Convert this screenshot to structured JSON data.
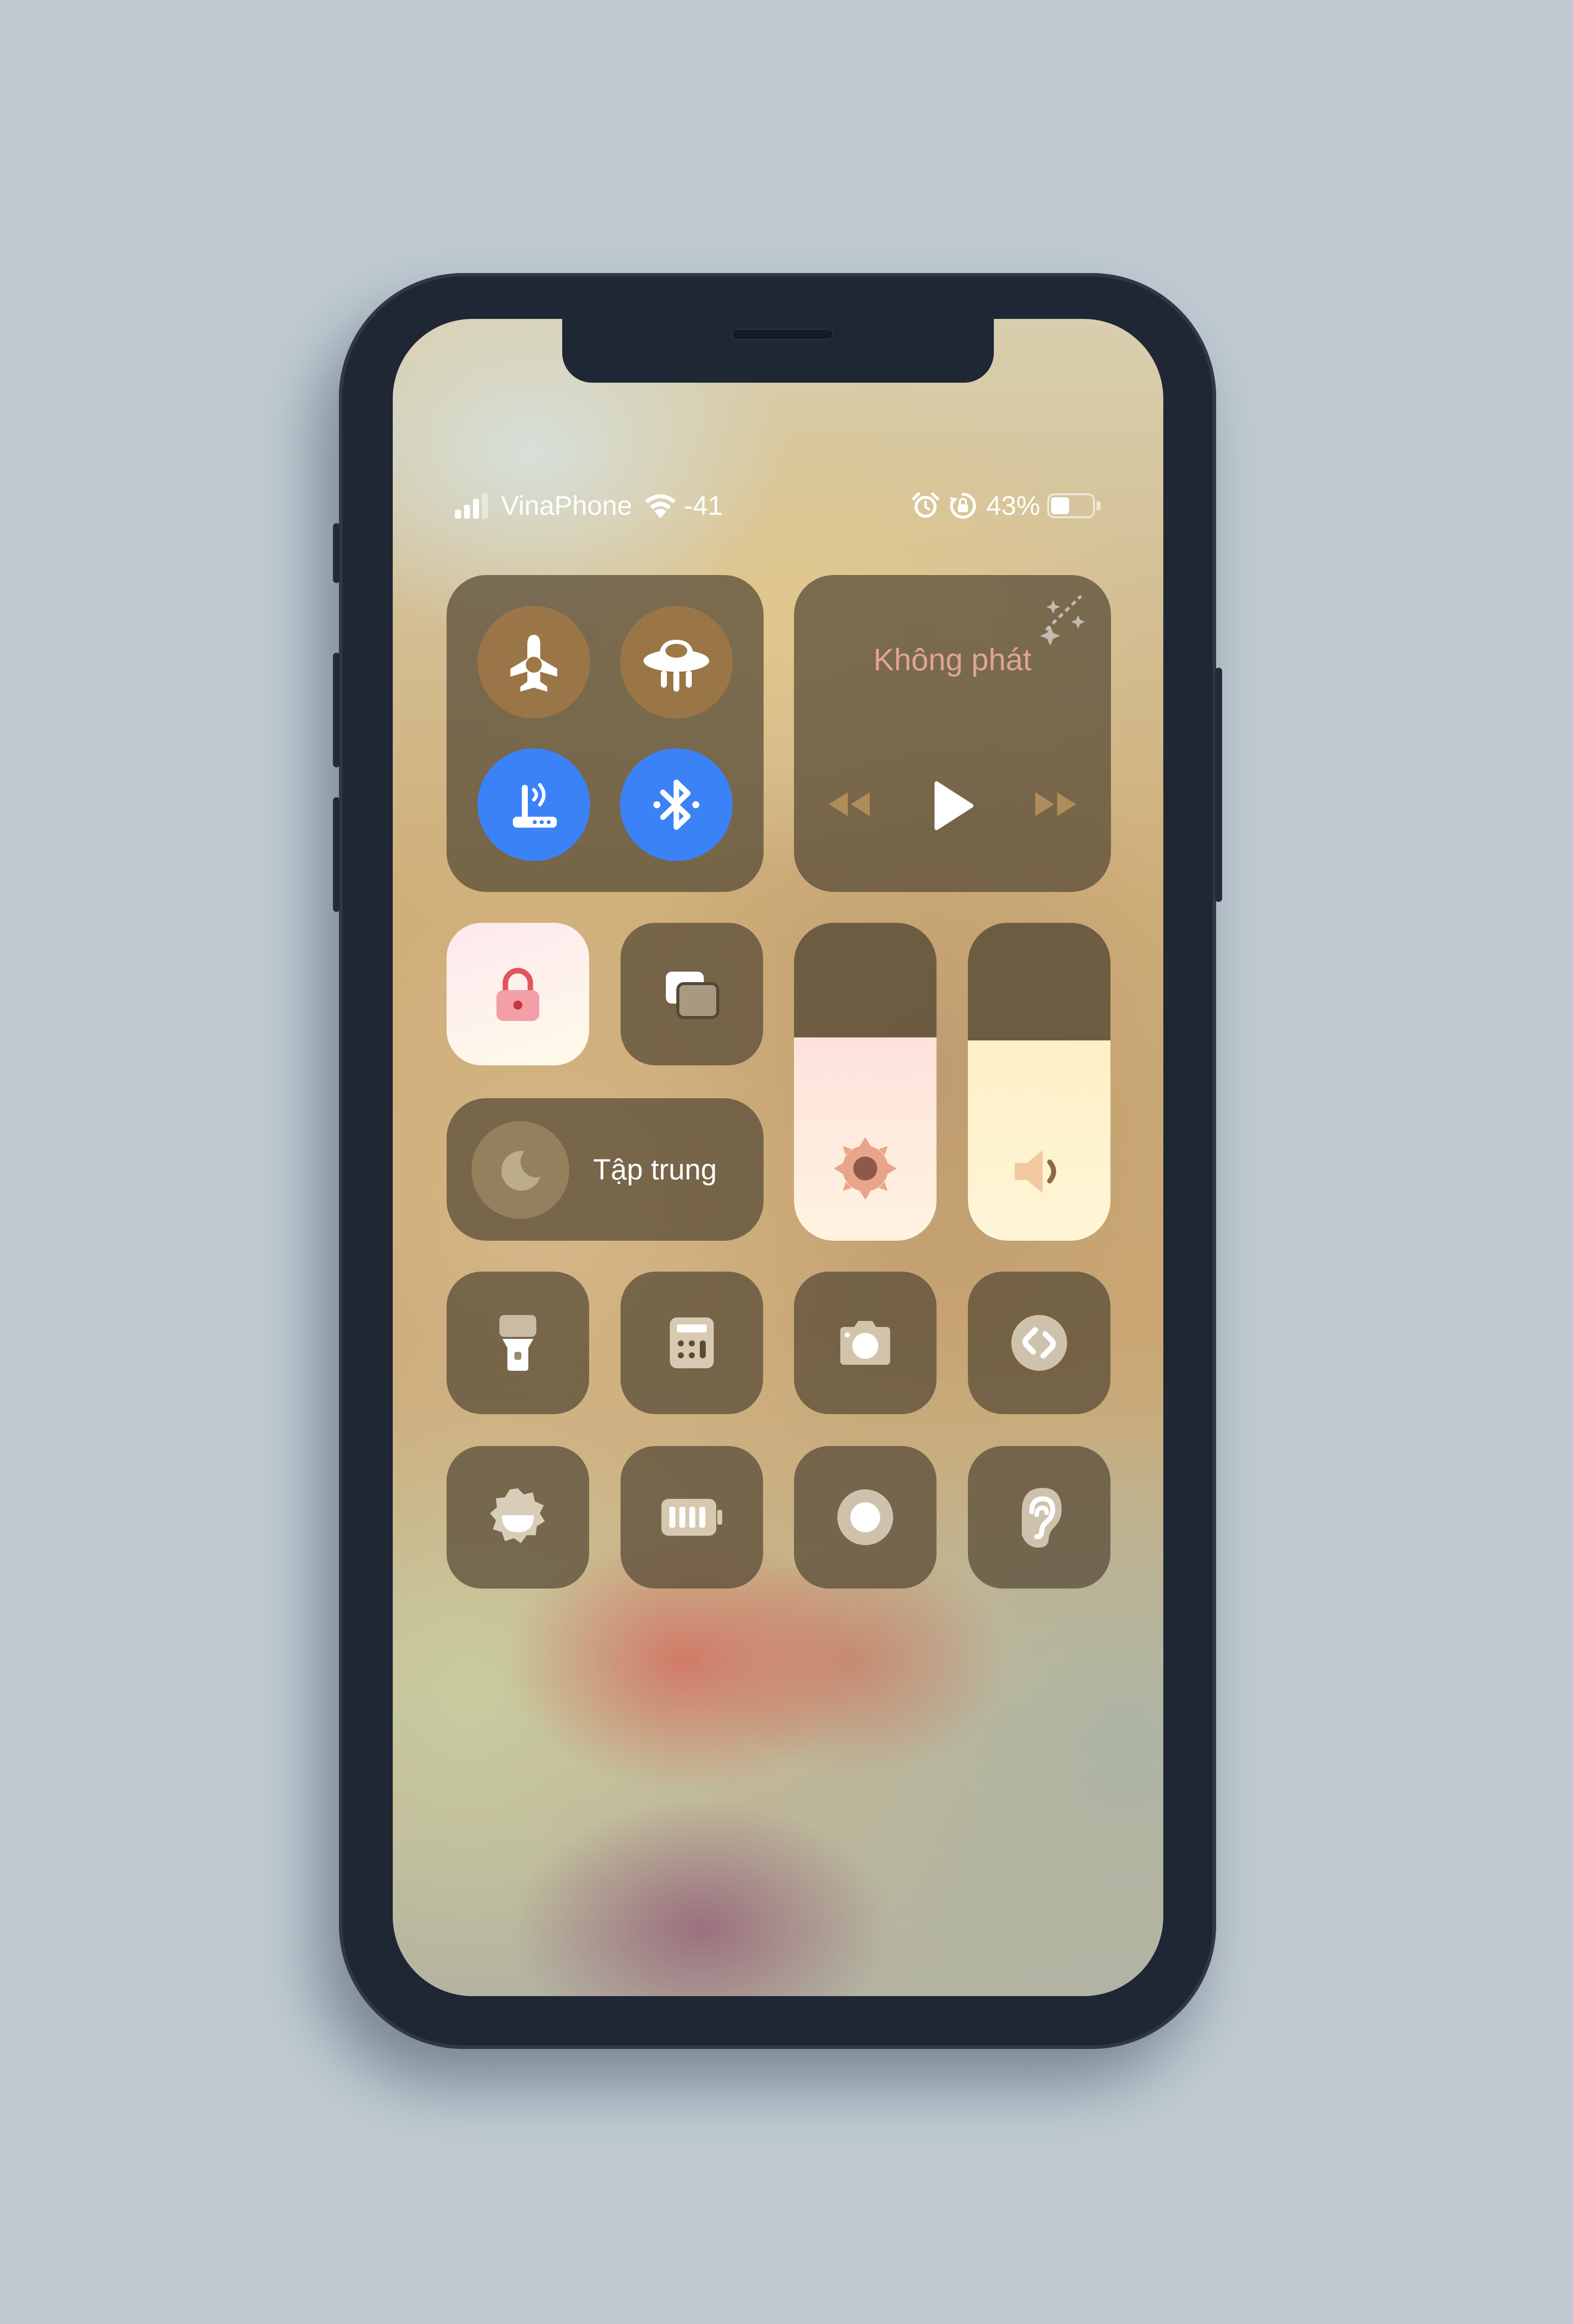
{
  "status_bar": {
    "carrier": "VinaPhone",
    "wifi_signal": "-41",
    "battery_percent": "43%",
    "battery_level": 0.43
  },
  "connectivity": {
    "airplane_label": "airplane-icon",
    "cellular_label": "cellular-data-icon",
    "wifi_label": "wifi-router-icon",
    "bluetooth_label": "bluetooth-icon"
  },
  "media": {
    "now_playing": "Không phát"
  },
  "focus": {
    "label": "Tập trung"
  },
  "sliders": {
    "brightness_level": 0.64,
    "volume_level": 0.63
  },
  "colors": {
    "accent_blue": "#3b82f7",
    "lock_red": "#e0555b",
    "now_playing_text": "#e0a494"
  }
}
